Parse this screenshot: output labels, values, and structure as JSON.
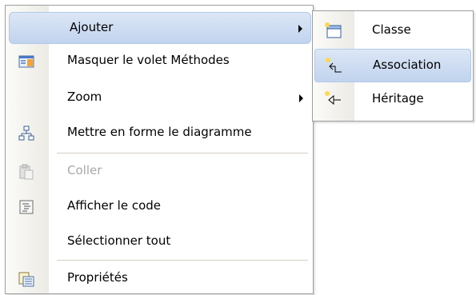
{
  "context_menu": {
    "items": [
      {
        "label": "Ajouter",
        "has_submenu": true,
        "highlighted": true
      },
      {
        "label": "Masquer le volet Méthodes",
        "icon": "hide-pane-icon"
      },
      {
        "label": "Zoom",
        "has_submenu": true
      },
      {
        "label": "Mettre en forme le diagramme",
        "icon": "layout-diagram-icon"
      },
      {
        "label": "Coller",
        "icon": "paste-icon",
        "disabled": true
      },
      {
        "label": "Afficher le code",
        "icon": "view-code-icon"
      },
      {
        "label": "Sélectionner tout"
      },
      {
        "label": "Propriétés",
        "icon": "properties-icon"
      }
    ]
  },
  "submenu": {
    "items": [
      {
        "label": "Classe",
        "icon": "class-icon"
      },
      {
        "label": "Association",
        "icon": "association-icon",
        "highlighted": true
      },
      {
        "label": "Héritage",
        "icon": "inheritance-icon"
      }
    ]
  },
  "colors": {
    "highlight": "#c1d3ee",
    "border": "#9d9d9d",
    "disabled_text": "#a8a8a8"
  }
}
